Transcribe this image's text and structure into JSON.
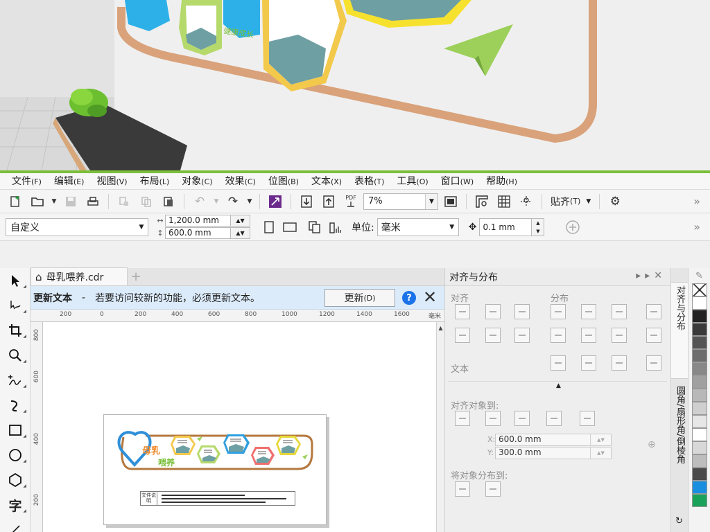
{
  "menubar": {
    "items": [
      {
        "label": "文件",
        "acc": "(F)"
      },
      {
        "label": "编辑",
        "acc": "(E)"
      },
      {
        "label": "视图",
        "acc": "(V)"
      },
      {
        "label": "布局",
        "acc": "(L)"
      },
      {
        "label": "对象",
        "acc": "(C)"
      },
      {
        "label": "效果",
        "acc": "(C)"
      },
      {
        "label": "位图",
        "acc": "(B)"
      },
      {
        "label": "文本",
        "acc": "(X)"
      },
      {
        "label": "表格",
        "acc": "(T)"
      },
      {
        "label": "工具",
        "acc": "(O)"
      },
      {
        "label": "窗口",
        "acc": "(W)"
      },
      {
        "label": "帮助",
        "acc": "(H)"
      }
    ]
  },
  "toolbar": {
    "zoom_value": "7%",
    "snap_label": "贴齐",
    "snap_acc": "(T)",
    "pdf_label": "PDF"
  },
  "propbar": {
    "preset_value": "自定义",
    "width_value": "1,200.0 mm",
    "height_value": "600.0 mm",
    "unit_label": "单位:",
    "unit_value": "毫米",
    "nudge_value": "0.1 mm"
  },
  "document": {
    "tab_title": "母乳喂养.cdr",
    "update_title": "更新文本",
    "update_dash": "-",
    "update_message": "若要访问较新的功能，必须更新文本。",
    "update_button": "更新",
    "update_button_acc": "(D)",
    "ruler_h_labels": [
      "200",
      "0",
      "200",
      "400",
      "600",
      "800",
      "1000",
      "1200",
      "1400",
      "1600",
      "毫米"
    ],
    "ruler_v_labels": [
      "800",
      "600",
      "400",
      "200"
    ],
    "note_label": "文件说明",
    "design": {
      "title_main": "母乳",
      "title_sub": "喂养"
    }
  },
  "docker": {
    "title": "对齐与分布",
    "section_align": "对齐",
    "section_distribute": "分布",
    "section_text": "文本",
    "section_align_to": "对齐对象到:",
    "x_label": "X:",
    "x_value": "600.0 mm",
    "y_label": "Y:",
    "y_value": "300.0 mm",
    "section_distribute_to": "将对象分布到:"
  },
  "vtabs": {
    "tab1": "对齐与分布",
    "tab2": "圆角/扇形角/倒棱角"
  },
  "palette": {
    "colors": [
      "#ffffff",
      "#222222",
      "#3a3a3a",
      "#555555",
      "#6d6d6d",
      "#888888",
      "#a0a0a0",
      "#b8b8b8",
      "#cfcfcf",
      "#e6e6e6",
      "#ffffff",
      "#d8d8d8",
      "#bdbdbd",
      "#4a4a4a",
      "#1a8fe0",
      "#19a35a"
    ]
  }
}
